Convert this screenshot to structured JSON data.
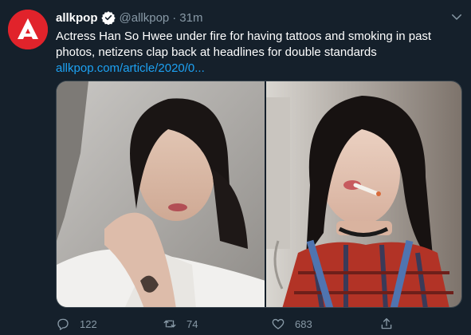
{
  "tweet": {
    "author_name": "allkpop",
    "handle": "@allkpop",
    "separator": "·",
    "time": "31m",
    "text": "Actress Han So Hwee under fire for having tattoos and smoking in past photos, netizens clap back at headlines for double standards",
    "link": "allkpop.com/article/2020/0...",
    "media": [
      "photo",
      "photo"
    ]
  },
  "actions": {
    "reply_count": "122",
    "retweet_count": "74",
    "like_count": "683"
  },
  "icons": {
    "avatar": "allkpop-logo",
    "verified": "verified-badge-icon",
    "caret": "chevron-down-icon",
    "reply": "reply-icon",
    "retweet": "retweet-icon",
    "like": "heart-icon",
    "share": "share-icon"
  },
  "colors": {
    "background": "#15202b",
    "text": "#ffffff",
    "secondary": "#8899a6",
    "link": "#1da1f2",
    "brand": "#e1232b"
  }
}
